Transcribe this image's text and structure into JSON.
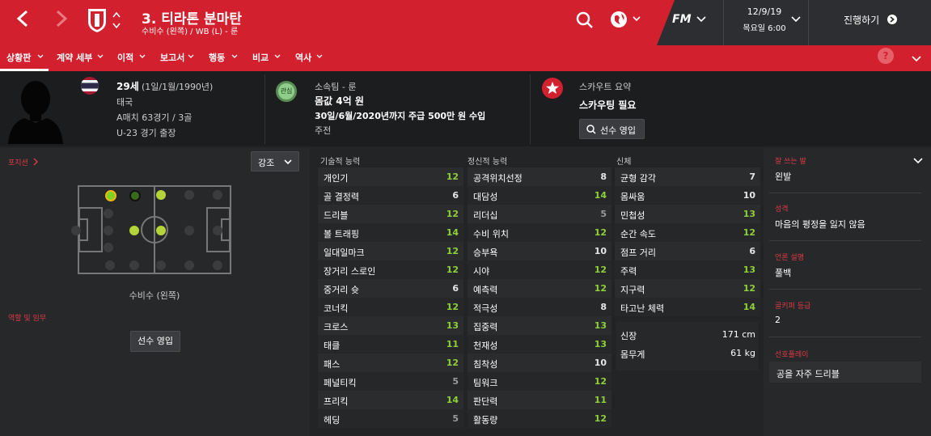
{
  "header": {
    "title": "3. 티라톤 분마탄",
    "subtitle": "수비수 (왼쪽) / WB (L) - 룬",
    "fm": "FM",
    "date": "12/9/19",
    "day_time": "목요일 6:00",
    "continue_label": "진행하기",
    "colors": {
      "brand": "#d2202f",
      "dark": "#2c2e31"
    }
  },
  "nav": {
    "items": [
      "상황판",
      "계약 세부",
      "이적",
      "보고서",
      "행동",
      "비교",
      "역사"
    ],
    "active": "상황판",
    "help": "?"
  },
  "info": {
    "age": "29세",
    "birth": "(1일/1월/1990년)",
    "nation": "태국",
    "caps": "A매치 63경기 / 3골",
    "u23": "U-23 경기 출장",
    "club_label": "소속팀 - 룬",
    "club_badge": "관심",
    "value": "몸값 4억 원",
    "contract": "30일/6월/2020년까지 주급 500만 원 수입",
    "role": "주전",
    "scout_label": "스카우트 요약",
    "scout_value": "스카우팅 필요",
    "scout_button": "선수 영입"
  },
  "left": {
    "position_label": "포지션",
    "highlight_label": "강조",
    "position_name": "수비수 (왼쪽)",
    "roles_label": "역할 및 임무",
    "sign_button": "선수 영입"
  },
  "attributes": {
    "technical_label": "기술적 능력",
    "mental_label": "정신적 능력",
    "physical_label": "신체",
    "technical": [
      {
        "name": "개인기",
        "value": "12"
      },
      {
        "name": "골 결정력",
        "value": "6"
      },
      {
        "name": "드리블",
        "value": "12"
      },
      {
        "name": "볼 트래핑",
        "value": "14"
      },
      {
        "name": "일대일마크",
        "value": "12"
      },
      {
        "name": "장거리 스로인",
        "value": "12"
      },
      {
        "name": "중거리 슛",
        "value": "6"
      },
      {
        "name": "코너킥",
        "value": "12"
      },
      {
        "name": "크로스",
        "value": "13"
      },
      {
        "name": "태클",
        "value": "11"
      },
      {
        "name": "패스",
        "value": "12"
      },
      {
        "name": "페널티킥",
        "value": "5"
      },
      {
        "name": "프리킥",
        "value": "14"
      },
      {
        "name": "헤딩",
        "value": "5"
      }
    ],
    "mental": [
      {
        "name": "공격위치선정",
        "value": "8"
      },
      {
        "name": "대담성",
        "value": "14"
      },
      {
        "name": "리더십",
        "value": "5"
      },
      {
        "name": "수비 위치",
        "value": "12"
      },
      {
        "name": "승부욕",
        "value": "10"
      },
      {
        "name": "시야",
        "value": "12"
      },
      {
        "name": "예측력",
        "value": "12"
      },
      {
        "name": "적극성",
        "value": "8"
      },
      {
        "name": "집중력",
        "value": "13"
      },
      {
        "name": "천재성",
        "value": "13"
      },
      {
        "name": "침착성",
        "value": "10"
      },
      {
        "name": "팀워크",
        "value": "12"
      },
      {
        "name": "판단력",
        "value": "11"
      },
      {
        "name": "활동량",
        "value": "12"
      }
    ],
    "physical": [
      {
        "name": "균형 감각",
        "value": "7"
      },
      {
        "name": "몸싸움",
        "value": "10"
      },
      {
        "name": "민첩성",
        "value": "13"
      },
      {
        "name": "순간 속도",
        "value": "12"
      },
      {
        "name": "점프 거리",
        "value": "6"
      },
      {
        "name": "주력",
        "value": "13"
      },
      {
        "name": "지구력",
        "value": "12"
      },
      {
        "name": "타고난 체력",
        "value": "14"
      }
    ],
    "height_label": "신장",
    "height": "171 cm",
    "weight_label": "몸무게",
    "weight": "61 kg"
  },
  "right": {
    "foot_label": "잘 쓰는 발",
    "foot": "왼발",
    "personality_label": "성격",
    "personality": "마음의 평정을 잃지 않음",
    "media_label": "언론 설명",
    "media": "풀백",
    "rep_label": "골키퍼 등급",
    "rep": "2",
    "pref_label": "선호플레이",
    "pref": "공을 자주 드리블"
  }
}
